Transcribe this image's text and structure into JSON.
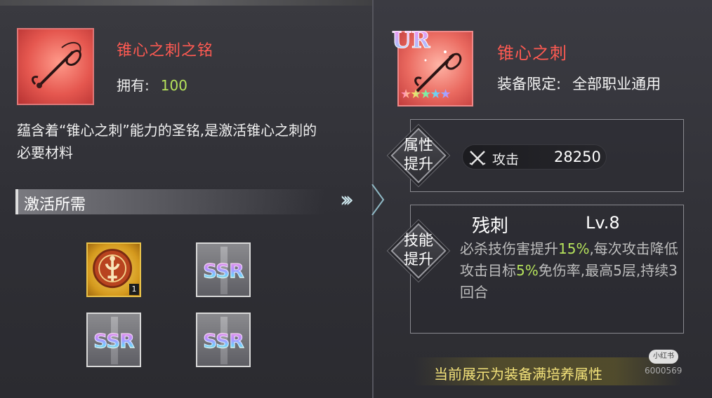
{
  "item": {
    "name": "锥心之刺之铭",
    "owned_label": "拥有:",
    "owned_count": "100",
    "description": "蕴含着“锥心之刺”能力的圣铭,是激活锥心之刺的必要材料"
  },
  "activation": {
    "section_title": "激活所需",
    "materials": [
      {
        "type": "gold-emblem",
        "count": "1"
      },
      {
        "type": "ssr",
        "label": "SSR"
      },
      {
        "type": "ssr",
        "label": "SSR"
      },
      {
        "type": "ssr",
        "label": "SSR"
      }
    ]
  },
  "transition_icon": "triple-chevron-right-icon",
  "equipment": {
    "rarity": "UR",
    "stars": 5,
    "name": "锥心之刺",
    "limit_label": "装备限定:",
    "limit_value": "全部职业通用"
  },
  "attribute_boost": {
    "label_line1": "属性",
    "label_line2": "提升",
    "stat_icon": "crossed-swords-icon",
    "stat_name": "攻击",
    "stat_value": "28250"
  },
  "skill_boost": {
    "label_line1": "技能",
    "label_line2": "提升",
    "skill_name": "残刺",
    "skill_level": "Lv.8",
    "desc_part1": "必杀技伤害提升",
    "desc_hl1": "15%",
    "desc_part2": ",每次攻击降低攻击目标",
    "desc_hl2": "5%",
    "desc_part3": "免伤率,最高5层,持续3回合"
  },
  "footer": {
    "note": "当前展示为装备满培养属性"
  },
  "watermark": {
    "logo": "小红书",
    "id": "6000569"
  },
  "colors": {
    "item_name": "#ff5a52",
    "highlight_green": "#b6e35c",
    "footer_yellow": "#f3e27a"
  }
}
